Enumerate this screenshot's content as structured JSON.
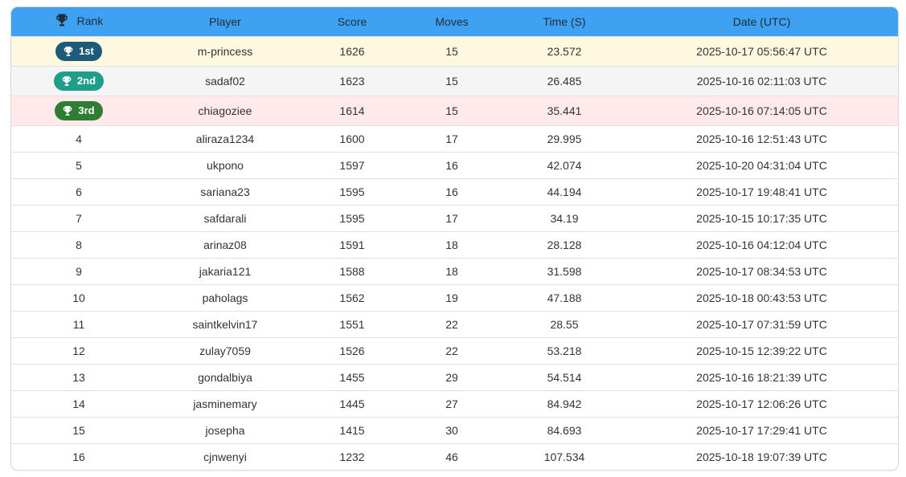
{
  "headers": {
    "rank": "Rank",
    "player": "Player",
    "score": "Score",
    "moves": "Moves",
    "time": "Time (S)",
    "date": "Date (UTC)"
  },
  "colors": {
    "header_bg": "#3ea1f2",
    "gold_badge": "#1e5a7a",
    "silver_badge": "#1f9e8c",
    "bronze_badge": "#2e7d32",
    "gold_row": "#fff8e1",
    "silver_row": "#f5f5f5",
    "bronze_row": "#ffe9ea"
  },
  "top": [
    {
      "rank": "1st",
      "player": "m-princess",
      "score": "1626",
      "moves": "15",
      "time": "23.572",
      "date": "2025-10-17 05:56:47 UTC",
      "icon": "trophy-icon"
    },
    {
      "rank": "2nd",
      "player": "sadaf02",
      "score": "1623",
      "moves": "15",
      "time": "26.485",
      "date": "2025-10-16 02:11:03 UTC",
      "icon": "trophy-icon"
    },
    {
      "rank": "3rd",
      "player": "chiagoziee",
      "score": "1614",
      "moves": "15",
      "time": "35.441",
      "date": "2025-10-16 07:14:05 UTC",
      "icon": "trophy-icon"
    }
  ],
  "rows": [
    {
      "rank": "4",
      "player": "aliraza1234",
      "score": "1600",
      "moves": "17",
      "time": "29.995",
      "date": "2025-10-16 12:51:43 UTC"
    },
    {
      "rank": "5",
      "player": "ukpono",
      "score": "1597",
      "moves": "16",
      "time": "42.074",
      "date": "2025-10-20 04:31:04 UTC"
    },
    {
      "rank": "6",
      "player": "sariana23",
      "score": "1595",
      "moves": "16",
      "time": "44.194",
      "date": "2025-10-17 19:48:41 UTC"
    },
    {
      "rank": "7",
      "player": "safdarali",
      "score": "1595",
      "moves": "17",
      "time": "34.19",
      "date": "2025-10-15 10:17:35 UTC"
    },
    {
      "rank": "8",
      "player": "arinaz08",
      "score": "1591",
      "moves": "18",
      "time": "28.128",
      "date": "2025-10-16 04:12:04 UTC"
    },
    {
      "rank": "9",
      "player": "jakaria121",
      "score": "1588",
      "moves": "18",
      "time": "31.598",
      "date": "2025-10-17 08:34:53 UTC"
    },
    {
      "rank": "10",
      "player": "paholags",
      "score": "1562",
      "moves": "19",
      "time": "47.188",
      "date": "2025-10-18 00:43:53 UTC"
    },
    {
      "rank": "11",
      "player": "saintkelvin17",
      "score": "1551",
      "moves": "22",
      "time": "28.55",
      "date": "2025-10-17 07:31:59 UTC"
    },
    {
      "rank": "12",
      "player": "zulay7059",
      "score": "1526",
      "moves": "22",
      "time": "53.218",
      "date": "2025-10-15 12:39:22 UTC"
    },
    {
      "rank": "13",
      "player": "gondalbiya",
      "score": "1455",
      "moves": "29",
      "time": "54.514",
      "date": "2025-10-16 18:21:39 UTC"
    },
    {
      "rank": "14",
      "player": "jasminemary",
      "score": "1445",
      "moves": "27",
      "time": "84.942",
      "date": "2025-10-17 12:06:26 UTC"
    },
    {
      "rank": "15",
      "player": "josepha",
      "score": "1415",
      "moves": "30",
      "time": "84.693",
      "date": "2025-10-17 17:29:41 UTC"
    },
    {
      "rank": "16",
      "player": "cjnwenyi",
      "score": "1232",
      "moves": "46",
      "time": "107.534",
      "date": "2025-10-18 19:07:39 UTC"
    }
  ]
}
